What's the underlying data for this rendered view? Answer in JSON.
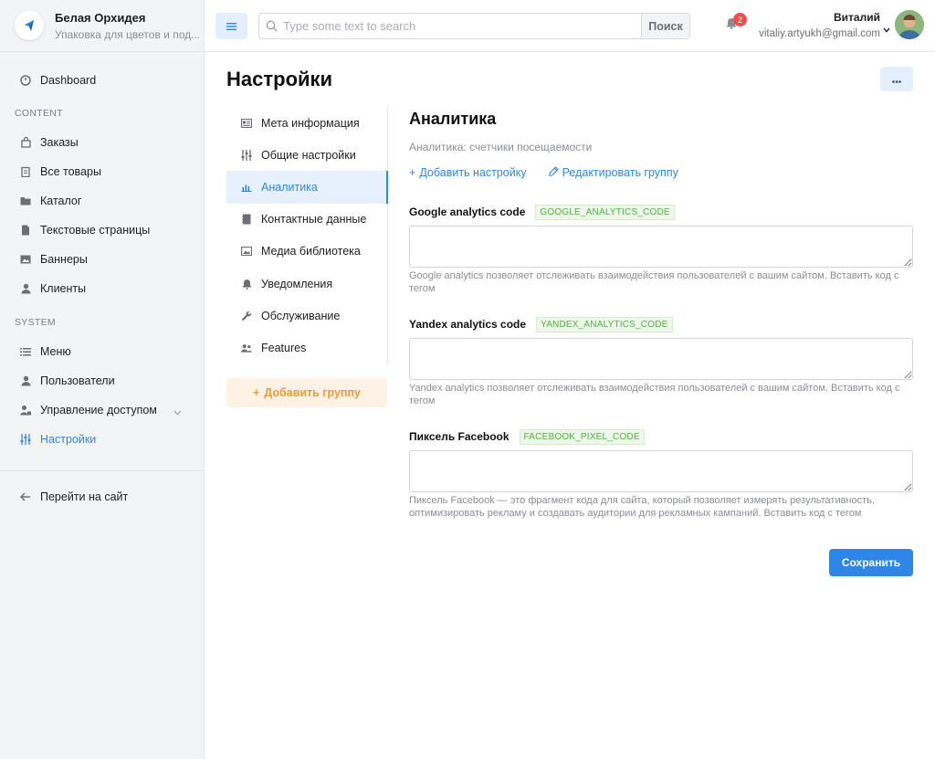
{
  "brand": {
    "name": "Белая Орхидея",
    "subtitle": "Упаковка для цветов и под..."
  },
  "sidebar": {
    "dashboard": "Dashboard",
    "content_section": "CONTENT",
    "content_items": [
      {
        "label": "Заказы",
        "icon": "bag-icon"
      },
      {
        "label": "Все товары",
        "icon": "clipboard-icon"
      },
      {
        "label": "Каталог",
        "icon": "folder-icon"
      },
      {
        "label": "Текстовые страницы",
        "icon": "file-icon"
      },
      {
        "label": "Баннеры",
        "icon": "image-icon"
      },
      {
        "label": "Клиенты",
        "icon": "user-icon"
      }
    ],
    "system_section": "SYSTEM",
    "system_items": [
      {
        "label": "Меню",
        "icon": "list-icon"
      },
      {
        "label": "Пользователи",
        "icon": "user-icon"
      },
      {
        "label": "Управление доступом",
        "icon": "user-lock-icon"
      },
      {
        "label": "Настройки",
        "icon": "sliders-icon"
      }
    ],
    "goto_site": "Перейти на сайт"
  },
  "topbar": {
    "search_placeholder": "Type some text to search",
    "search_button": "Поиск",
    "notifications_count": "2",
    "user_name": "Виталий",
    "user_email": "vitaliy.artyukh@gmail.com"
  },
  "page": {
    "title": "Настройки"
  },
  "settings_nav": {
    "items": [
      {
        "label": "Мета информация",
        "icon": "newspaper-icon"
      },
      {
        "label": "Общие настройки",
        "icon": "sliders-icon"
      },
      {
        "label": "Аналитика",
        "icon": "bar-chart-icon"
      },
      {
        "label": "Контактные данные",
        "icon": "address-book-icon"
      },
      {
        "label": "Медиа библиотека",
        "icon": "image-icon"
      },
      {
        "label": "Уведомления",
        "icon": "bell-icon"
      },
      {
        "label": "Обслуживание",
        "icon": "wrench-icon"
      },
      {
        "label": "Features",
        "icon": "users-icon"
      }
    ],
    "add_group": "Добавить группу"
  },
  "section": {
    "title": "Аналитика",
    "subtitle": "Аналитика: счетчики посещаемости",
    "add_setting": "Добавить настройку",
    "edit_group": "Редактировать группу"
  },
  "fields": [
    {
      "label": "Google analytics code",
      "code": "GOOGLE_ANALYTICS_CODE",
      "value": "",
      "help": "Google analytics позволяет отслеживать взаимодействия пользователей с вашим сайтом. Вставить код с тегом"
    },
    {
      "label": "Yandex analytics code",
      "code": "YANDEX_ANALYTICS_CODE",
      "value": "",
      "help": "Yandex analytics позволяет отслеживать взаимодействия пользователей с вашим сайтом. Вставить код с тегом"
    },
    {
      "label": "Пиксель Facebook",
      "code": "FACEBOOK_PIXEL_CODE",
      "value": "",
      "help": "Пиксель Facebook — это фрагмент кода для сайта, который позволяет измерять результативность, оптимизировать рекламу и создавать аудитории для рекламных кампаний. Вставить код с тегом"
    }
  ],
  "save_button": "Сохранить",
  "colors": {
    "accent": "#2f86e6",
    "badge": "#f04d4d",
    "code_green": "#52b043",
    "add_group_orange": "#e79b3a"
  }
}
